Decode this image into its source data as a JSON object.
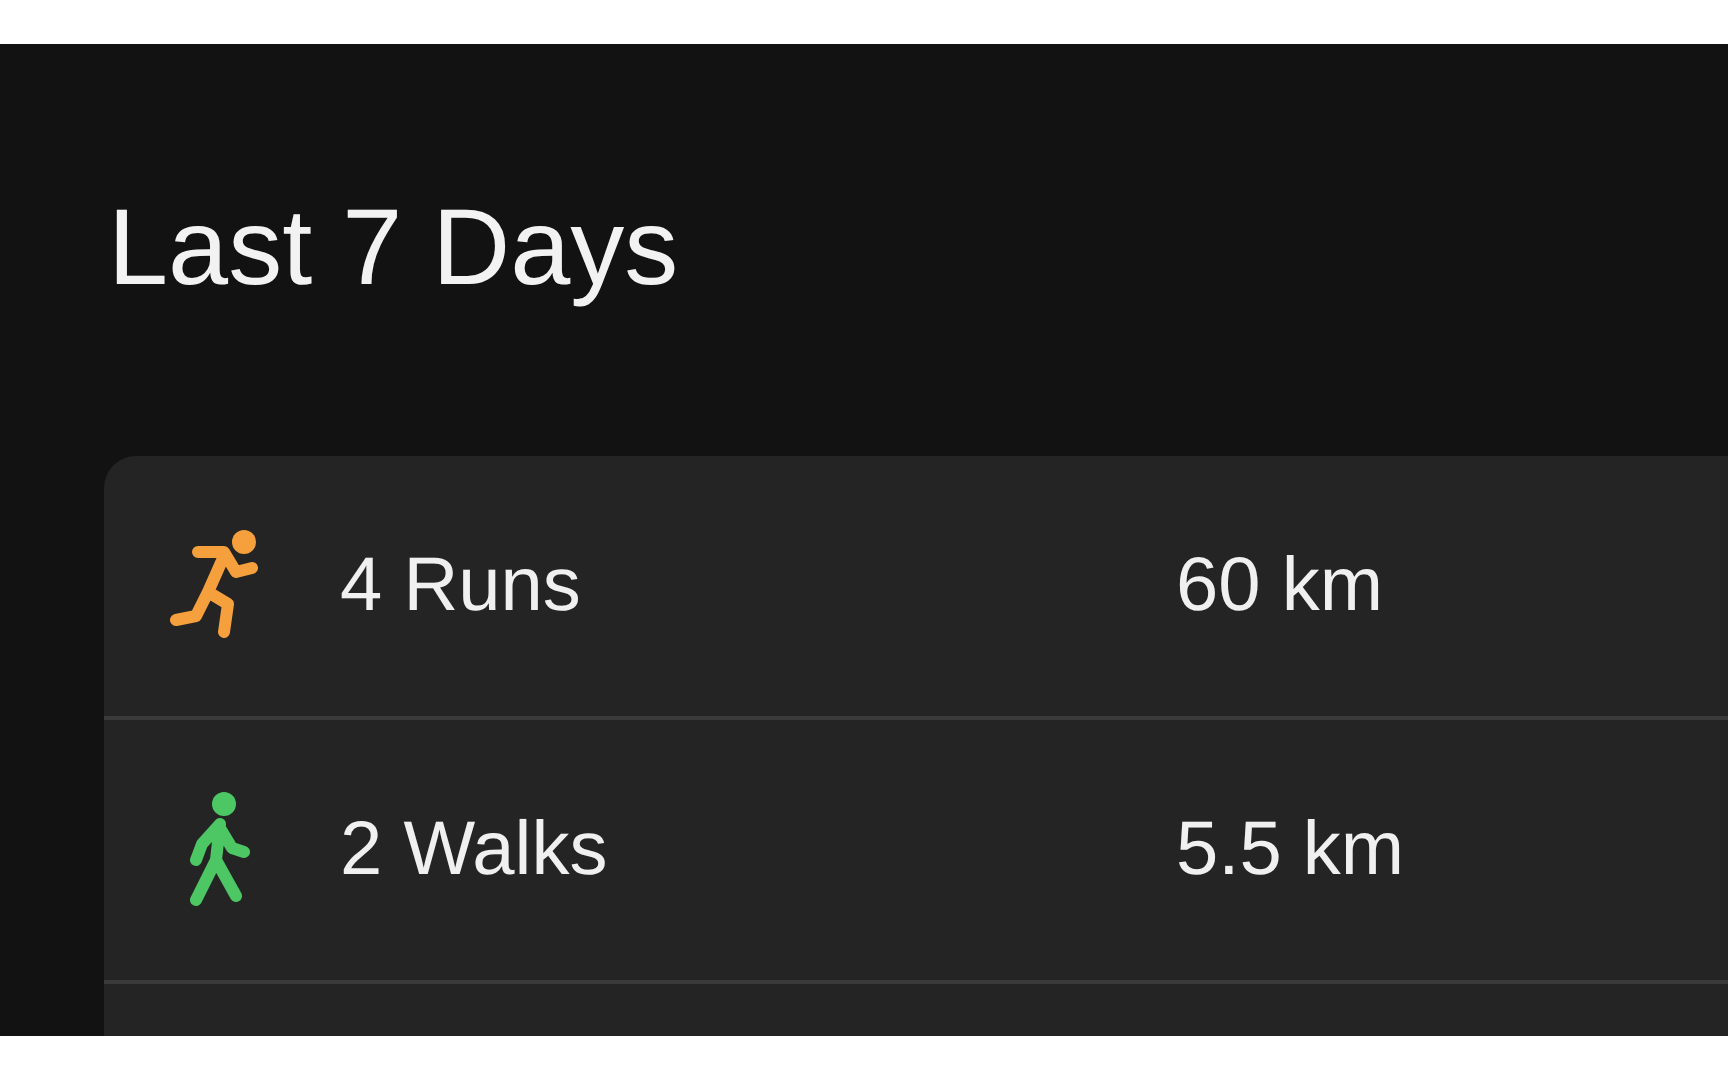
{
  "title": "Last 7 Days",
  "activities": [
    {
      "kind": "run",
      "color": "#f5a03c",
      "label": "4 Runs",
      "distance": "60 km"
    },
    {
      "kind": "walk",
      "color": "#4cc764",
      "label": "2 Walks",
      "distance": "5.5 km"
    }
  ]
}
